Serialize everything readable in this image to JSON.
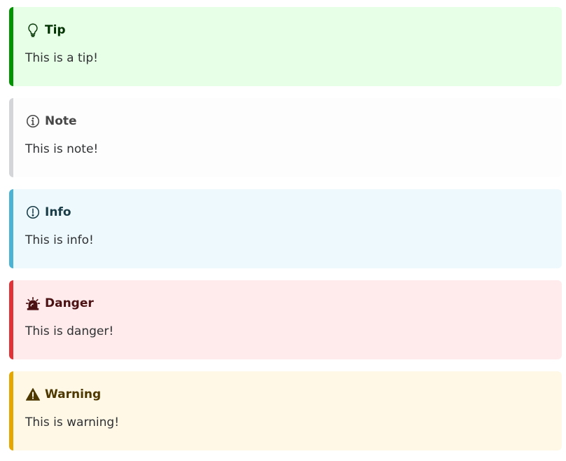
{
  "admonitions": [
    {
      "kind": "tip",
      "icon": "lightbulb-icon",
      "title": "Tip",
      "text": "This is a tip!",
      "accent": "#009400",
      "background": "#e6ffe6"
    },
    {
      "kind": "note",
      "icon": "info-circle-icon",
      "title": "Note",
      "text": "This is note!",
      "accent": "#d4d5d8",
      "background": "#fdfdfe"
    },
    {
      "kind": "info",
      "icon": "exclamation-circle-icon",
      "title": "Info",
      "text": "This is info!",
      "accent": "#4cb3d4",
      "background": "#eef9fd"
    },
    {
      "kind": "danger",
      "icon": "siren-icon",
      "title": "Danger",
      "text": "This is danger!",
      "accent": "#e13238",
      "background": "#ffebec"
    },
    {
      "kind": "warning",
      "icon": "warning-triangle-icon",
      "title": "Warning",
      "text": "This is warning!",
      "accent": "#e6a700",
      "background": "#fff8e6"
    }
  ]
}
